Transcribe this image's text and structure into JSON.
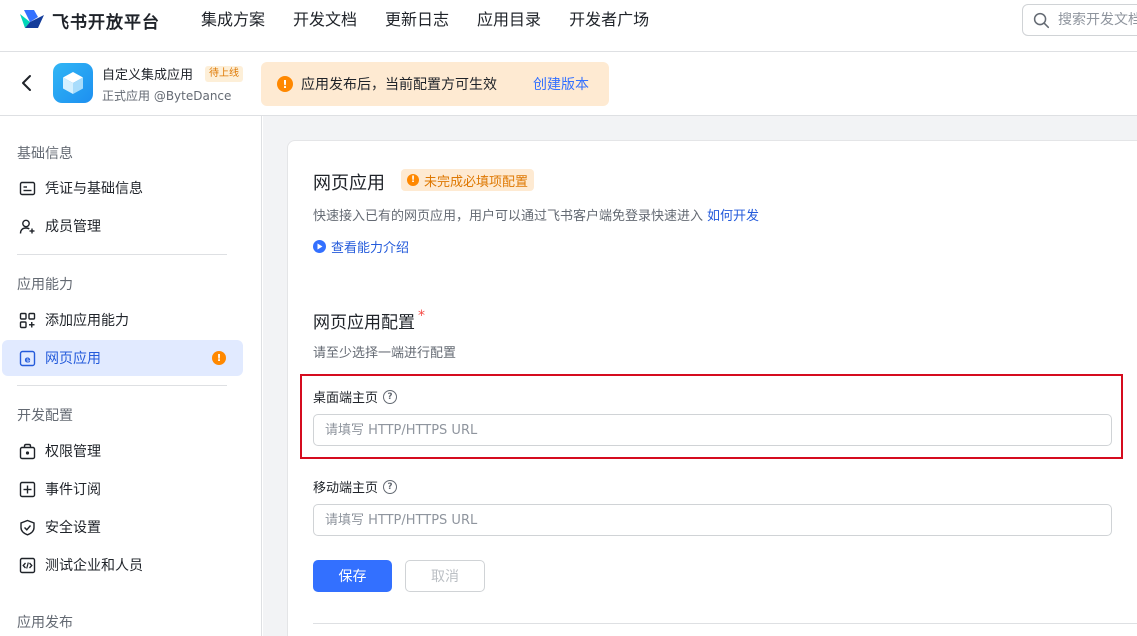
{
  "topbar": {
    "brand": "飞书开放平台",
    "nav": [
      "集成方案",
      "开发文档",
      "更新日志",
      "应用目录",
      "开发者广场"
    ],
    "search_placeholder": "搜索开发文档"
  },
  "app": {
    "name": "自定义集成应用",
    "status_tag": "待上线",
    "subtitle": "正式应用 @ByteDance",
    "notice": "应用发布后，当前配置方可生效",
    "notice_action": "创建版本"
  },
  "sidebar": {
    "groups": [
      {
        "title": "基础信息",
        "items": [
          {
            "label": "凭证与基础信息",
            "icon": "credential-icon"
          },
          {
            "label": "成员管理",
            "icon": "add-member-icon"
          }
        ]
      },
      {
        "title": "应用能力",
        "items": [
          {
            "label": "添加应用能力",
            "icon": "grid-plus-icon"
          },
          {
            "label": "网页应用",
            "icon": "web-app-icon",
            "active": true,
            "badge": "!"
          }
        ]
      },
      {
        "title": "开发配置",
        "items": [
          {
            "label": "权限管理",
            "icon": "permission-icon"
          },
          {
            "label": "事件订阅",
            "icon": "event-icon"
          },
          {
            "label": "安全设置",
            "icon": "shield-icon"
          },
          {
            "label": "测试企业和人员",
            "icon": "code-icon"
          }
        ]
      },
      {
        "title": "应用发布",
        "items": []
      }
    ]
  },
  "main": {
    "title": "网页应用",
    "warning_tag": "未完成必填项配置",
    "description": "快速接入已有的网页应用，用户可以通过飞书客户端免登录快速进入",
    "description_link": "如何开发",
    "video_link": "查看能力介绍",
    "config_title": "网页应用配置",
    "required_mark": "*",
    "config_desc": "请至少选择一端进行配置",
    "desktop_label": "桌面端主页",
    "desktop_placeholder": "请填写 HTTP/HTTPS URL",
    "mobile_label": "移动端主页",
    "mobile_placeholder": "请填写 HTTP/HTTPS URL",
    "save": "保存",
    "cancel": "取消"
  },
  "colors": {
    "primary": "#3370ff",
    "warning": "#ff8800",
    "highlight": "#d50c1f"
  }
}
